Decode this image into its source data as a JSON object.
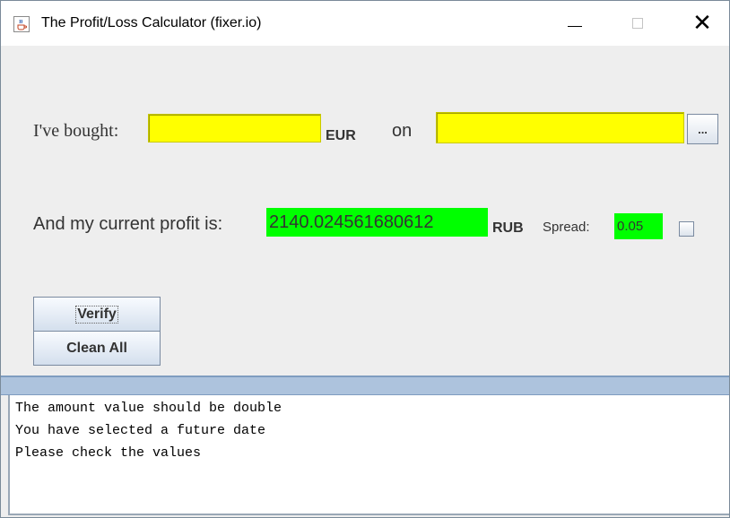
{
  "window": {
    "title": "The Profit/Loss Calculator (fixer.io)",
    "controls": {
      "minimize_icon": "minimize-icon",
      "maximize_icon": "maximize-icon",
      "close_glyph": "✕"
    },
    "app_icon": "java-cup-icon"
  },
  "form": {
    "bought_label": "I've bought:",
    "amount_value": "",
    "amount_currency": "EUR",
    "on_label": "on",
    "date_value": "",
    "date_picker_label": "...",
    "profit_label": "And my current profit is:",
    "profit_value": "2140.024561680612",
    "profit_currency": "RUB",
    "spread_label": "Spread:",
    "spread_value": "0.05",
    "spread_checkbox_checked": false
  },
  "buttons": {
    "verify": "Verify",
    "clean_all": "Clean All"
  },
  "log": {
    "lines": [
      "The amount value should be double",
      "You have selected a future date",
      "Please check the values"
    ]
  },
  "colors": {
    "input_yellow": "#ffff00",
    "result_green": "#00ff00",
    "divider_blue": "#adc3dd",
    "window_bg": "#eeeeee"
  }
}
